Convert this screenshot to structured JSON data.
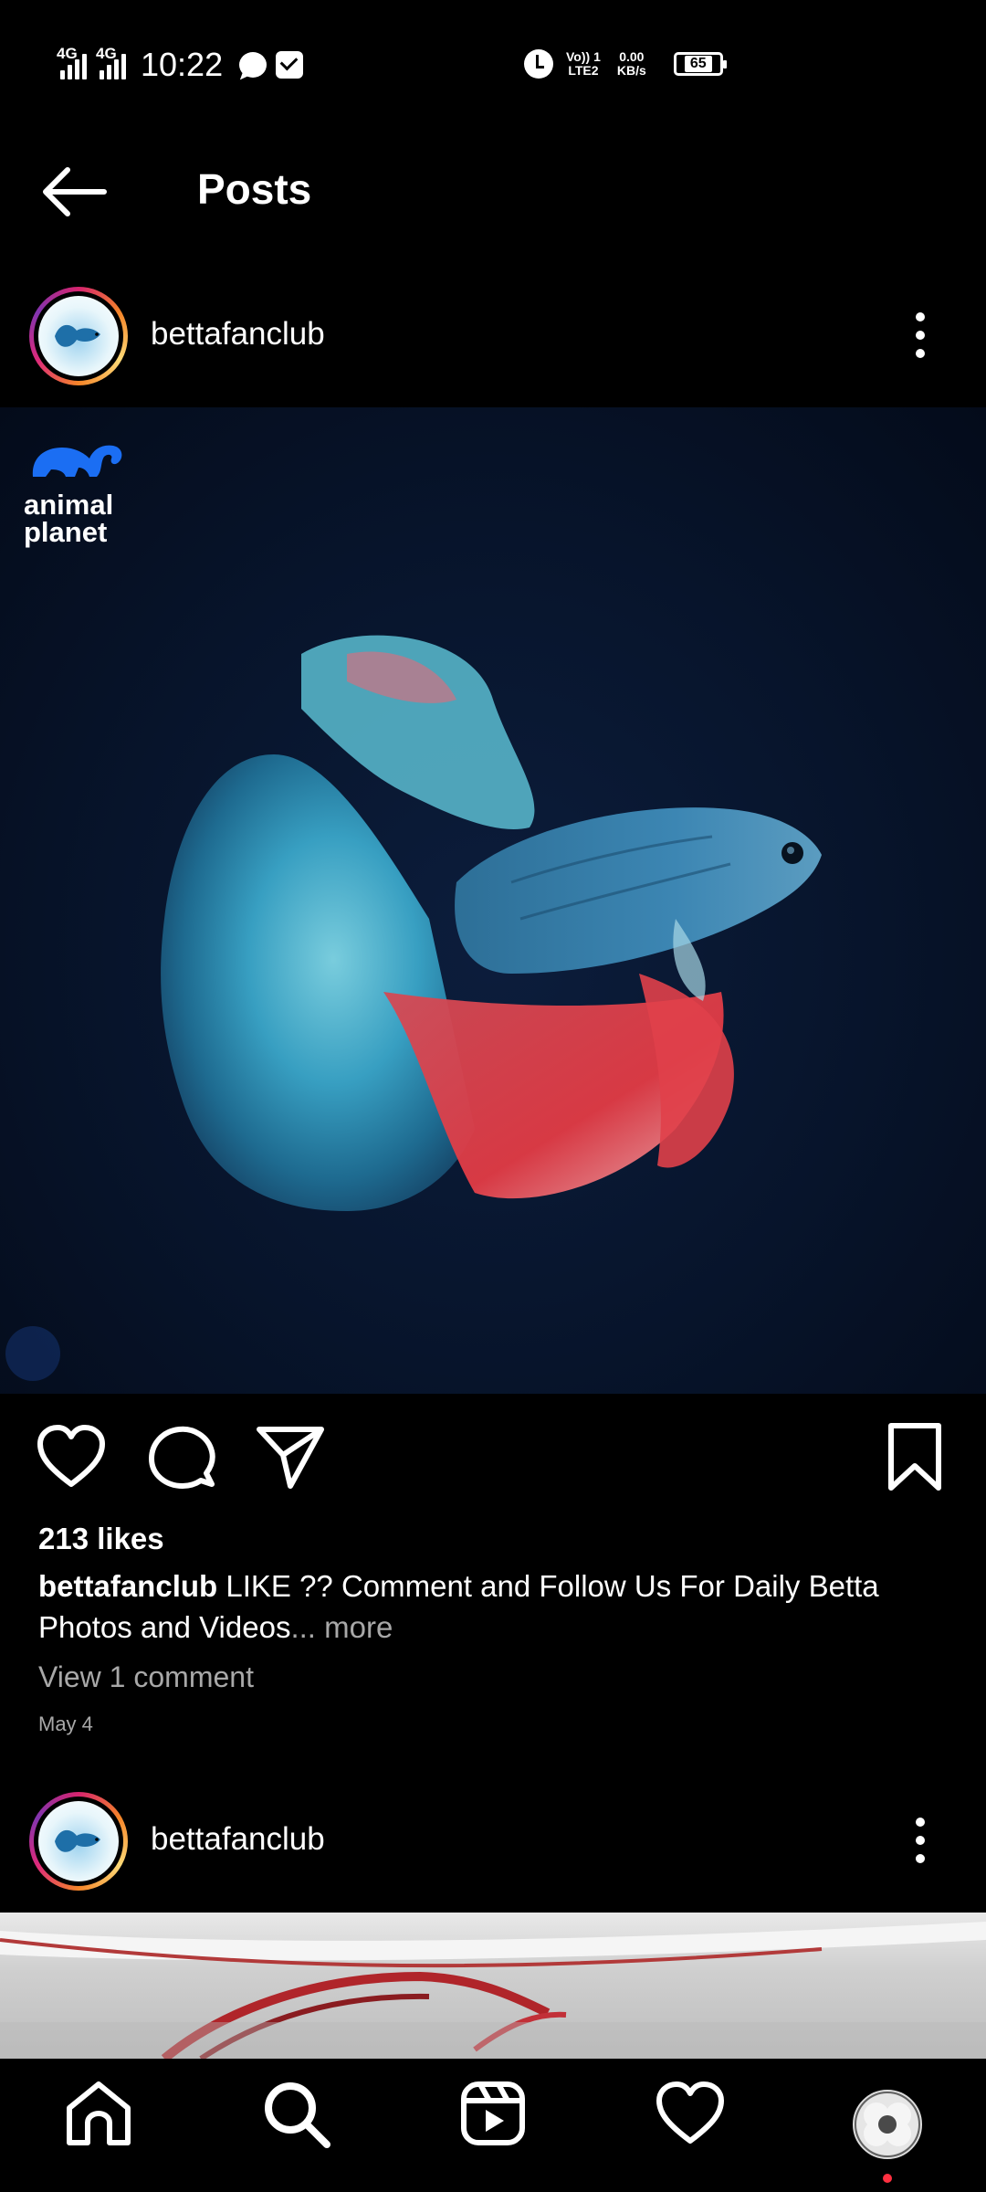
{
  "status_bar": {
    "time": "10:22",
    "network_1": "4G",
    "network_2": "4G",
    "volte_line1": "Vo)) 1",
    "volte_line2": "LTE2",
    "speed_value": "0.00",
    "speed_unit": "KB/s",
    "battery": "65",
    "icons": [
      "signal-icon",
      "signal-icon",
      "chat-icon",
      "mail-icon",
      "alarm-icon",
      "battery-icon"
    ]
  },
  "header": {
    "title": "Posts",
    "back_icon": "arrow-left-icon"
  },
  "posts": [
    {
      "username": "bettafanclub",
      "watermark_line1": "animal",
      "watermark_line2": "planet",
      "likes": "213 likes",
      "caption_user": "bettafanclub",
      "caption_text": " LIKE ?? Comment and Follow Us For Daily Betta Photos and Videos",
      "caption_more": "... more",
      "view_comments": "View 1 comment",
      "date": "May 4"
    },
    {
      "username": "bettafanclub"
    }
  ],
  "actions": {
    "icons": [
      "heart-icon",
      "comment-icon",
      "share-icon",
      "bookmark-icon"
    ]
  },
  "bottom_nav": {
    "items": [
      "home-icon",
      "search-icon",
      "reels-icon",
      "activity-icon",
      "profile-avatar"
    ]
  },
  "colors": {
    "background": "#000000",
    "secondary_text": "#a8a8a8",
    "notification_dot": "#ff3040",
    "ring_pink": "#d6246e",
    "ring_orange": "#f58529"
  }
}
